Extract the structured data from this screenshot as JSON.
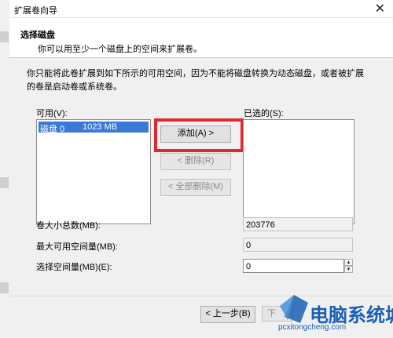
{
  "window": {
    "title": "扩展卷向导",
    "close_glyph": "✕"
  },
  "header": {
    "heading": "选择磁盘",
    "subheading": "你可以用至少一个磁盘上的空间来扩展卷。"
  },
  "description": "你只能将此卷扩展到如下所示的可用空间，因为不能将磁盘转换为动态磁盘，或者被扩展的卷是启动卷或系统卷。",
  "available": {
    "label": "可用(V):",
    "items": [
      {
        "disk": "磁盘 0",
        "size": "1023 MB"
      }
    ]
  },
  "selected": {
    "label": "已选的(S):"
  },
  "buttons": {
    "add": "添加(A) >",
    "remove": "< 删除(R)",
    "remove_all": "< 全部删除(M)",
    "back": "< 上一步(B)",
    "next": "下"
  },
  "fields": {
    "total_label": "卷大小总数(MB):",
    "total_value": "203776",
    "max_label": "最大可用空间量(MB):",
    "max_value": "0",
    "select_label": "选择空间量(MB)(E):",
    "select_value": "0"
  },
  "watermark": {
    "text": "电脑系统城",
    "url": "pcxitongcheng.com"
  },
  "colors": {
    "highlight": "#e0282e",
    "selection": "#3b79d7",
    "watermark": "#1b5fb5"
  }
}
